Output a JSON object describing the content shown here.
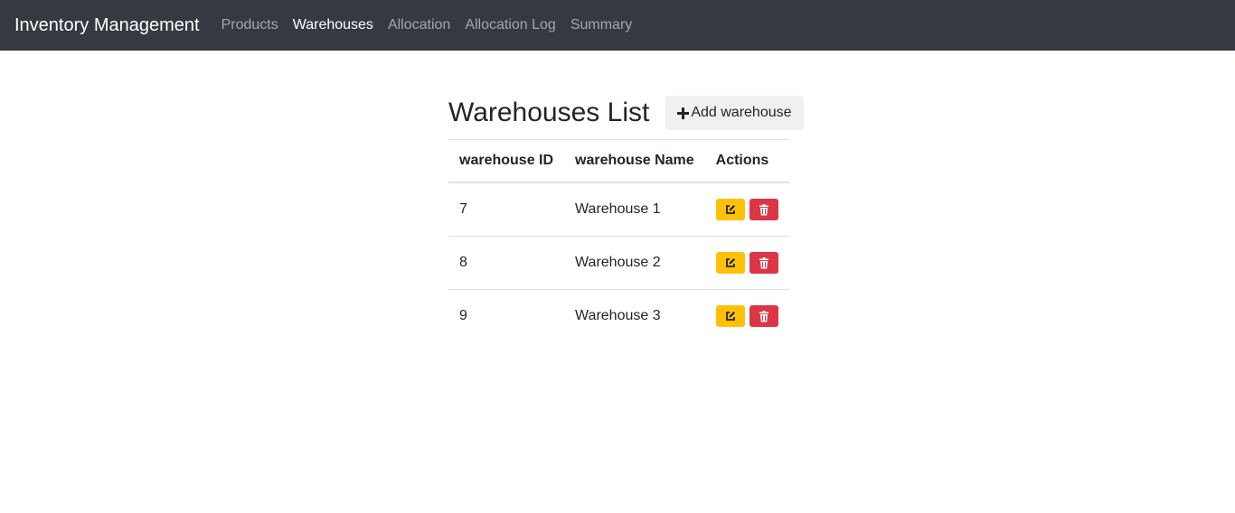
{
  "nav": {
    "brand": "Inventory Management",
    "links": [
      {
        "label": "Products",
        "active": false
      },
      {
        "label": "Warehouses",
        "active": true
      },
      {
        "label": "Allocation",
        "active": false
      },
      {
        "label": "Allocation Log",
        "active": false
      },
      {
        "label": "Summary",
        "active": false
      }
    ]
  },
  "main": {
    "title": "Warehouses List",
    "add_label": "Add warehouse",
    "add_icon": "plus-icon"
  },
  "table": {
    "headers": [
      "warehouse ID",
      "warehouse Name",
      "Actions"
    ],
    "rows": [
      {
        "id": "7",
        "name": "Warehouse 1"
      },
      {
        "id": "8",
        "name": "Warehouse 2"
      },
      {
        "id": "9",
        "name": "Warehouse 3"
      }
    ],
    "edit_icon": "edit-icon",
    "delete_icon": "trash-icon"
  },
  "colors": {
    "navbar": "#343a40",
    "edit": "#ffc107",
    "delete": "#dc3545"
  }
}
